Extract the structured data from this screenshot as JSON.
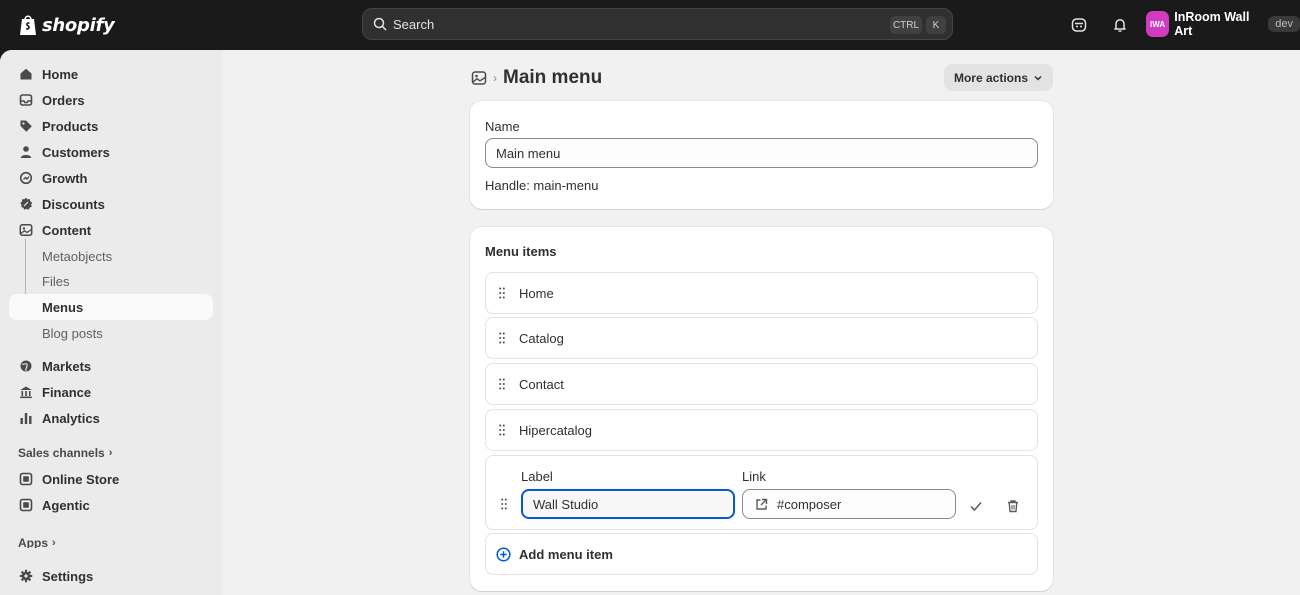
{
  "topbar": {
    "brand": "shopify",
    "search_placeholder": "Search",
    "shortcut_ctrl": "CTRL",
    "shortcut_key": "K",
    "store_initials": "IWA",
    "store_name": "InRoom Wall Art",
    "store_env": "dev"
  },
  "sidebar": {
    "items": [
      {
        "label": "Home",
        "icon": "home-icon"
      },
      {
        "label": "Orders",
        "icon": "inbox-icon"
      },
      {
        "label": "Products",
        "icon": "tag-icon"
      },
      {
        "label": "Customers",
        "icon": "person-icon"
      },
      {
        "label": "Growth",
        "icon": "growth-icon"
      },
      {
        "label": "Discounts",
        "icon": "discount-icon"
      },
      {
        "label": "Content",
        "icon": "content-icon"
      }
    ],
    "content_sub": [
      "Metaobjects",
      "Files",
      "Menus",
      "Blog posts"
    ],
    "items2": [
      {
        "label": "Markets",
        "icon": "globe-icon"
      },
      {
        "label": "Finance",
        "icon": "bank-icon"
      },
      {
        "label": "Analytics",
        "icon": "bar-chart-icon"
      }
    ],
    "sales_channels_label": "Sales channels",
    "channels": [
      {
        "label": "Online Store",
        "icon": "store-icon"
      },
      {
        "label": "Agentic",
        "icon": "agent-icon"
      }
    ],
    "apps_label": "Apps",
    "settings_label": "Settings"
  },
  "page": {
    "title": "Main menu",
    "more_actions": "More actions"
  },
  "name_card": {
    "name_label": "Name",
    "name_value": "Main menu",
    "handle_text": "Handle: main-menu"
  },
  "menu_card": {
    "title": "Menu items",
    "items": [
      "Home",
      "Catalog",
      "Contact",
      "Hipercatalog"
    ],
    "edit": {
      "label_label": "Label",
      "label_value": "Wall Studio",
      "link_label": "Link",
      "link_value": "#composer"
    },
    "add_label": "Add menu item"
  },
  "colors": {
    "accent": "#005bd3",
    "topbar": "#1a1a1a",
    "avatar": "#d13bc2"
  }
}
